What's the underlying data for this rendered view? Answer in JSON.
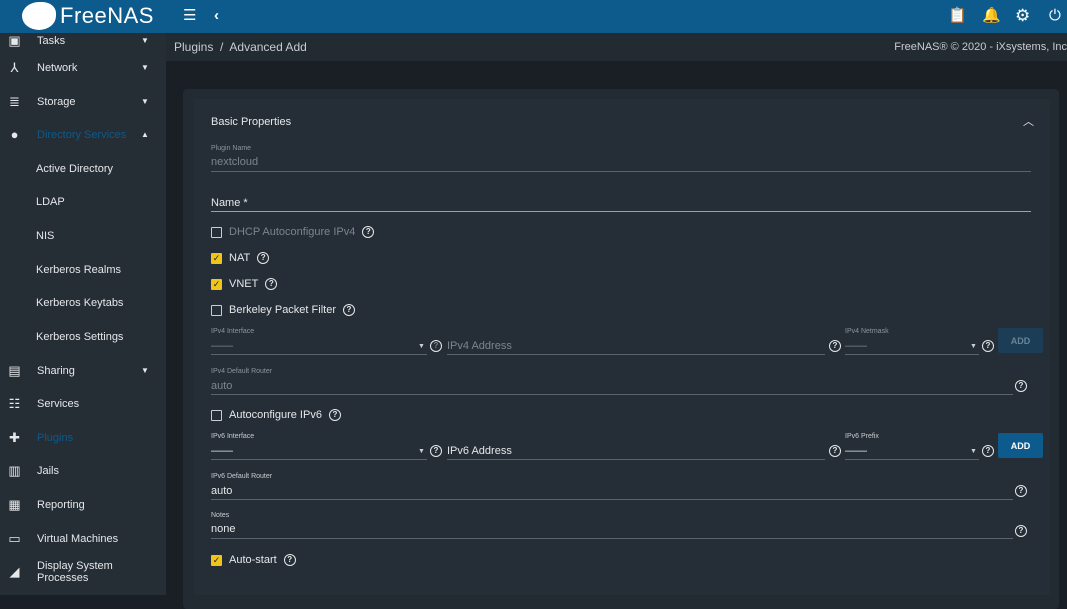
{
  "app": {
    "name": "FreeNAS"
  },
  "header": {
    "icons": [
      "menu-icon",
      "chevron-left-icon",
      "clipboard-icon",
      "bell-icon",
      "gear-icon",
      "power-icon"
    ]
  },
  "sidebar": {
    "items": [
      {
        "label": "Tasks",
        "icon": "calendar-icon",
        "caret": "▼"
      },
      {
        "label": "Network",
        "icon": "network-icon",
        "caret": "▼"
      },
      {
        "label": "Storage",
        "icon": "storage-icon",
        "caret": "▼"
      },
      {
        "label": "Directory Services",
        "icon": "directory-icon",
        "caret": "▲",
        "active": true
      },
      {
        "label": "Active Directory",
        "sub": true
      },
      {
        "label": "LDAP",
        "sub": true
      },
      {
        "label": "NIS",
        "sub": true
      },
      {
        "label": "Kerberos Realms",
        "sub": true
      },
      {
        "label": "Kerberos Keytabs",
        "sub": true
      },
      {
        "label": "Kerberos Settings",
        "sub": true
      },
      {
        "label": "Sharing",
        "icon": "sharing-icon",
        "caret": "▼"
      },
      {
        "label": "Services",
        "icon": "sliders-icon"
      },
      {
        "label": "Plugins",
        "icon": "puzzle-icon",
        "active": true
      },
      {
        "label": "Jails",
        "icon": "jail-icon"
      },
      {
        "label": "Reporting",
        "icon": "chart-icon"
      },
      {
        "label": "Virtual Machines",
        "icon": "laptop-icon"
      },
      {
        "label": "Display System Processes",
        "icon": "processes-icon"
      }
    ]
  },
  "breadcrumb": {
    "parent": "Plugins",
    "sep": "/",
    "current": "Advanced Add"
  },
  "copyright": "FreeNAS® © 2020 - iXsystems, Inc",
  "form": {
    "section_title": "Basic Properties",
    "plugin_name_label": "Plugin Name",
    "plugin_name": "nextcloud",
    "name_label": "Name *",
    "dhcp": "DHCP Autoconfigure IPv4",
    "nat": "NAT",
    "vnet": "VNET",
    "bpf": "Berkeley Packet Filter",
    "ipv4_interface_label": "IPv4 Interface",
    "ipv4_interface": "——",
    "ipv4_address_placeholder": "IPv4 Address",
    "ipv4_netmask_label": "IPv4 Netmask",
    "ipv4_netmask": "——",
    "add": "ADD",
    "ipv4_router_label": "IPv4 Default Router",
    "ipv4_router": "auto",
    "auto_ipv6": "Autoconfigure IPv6",
    "ipv6_interface_label": "IPv6 Interface",
    "ipv6_interface": "——",
    "ipv6_address_placeholder": "IPv6 Address",
    "ipv6_prefix_label": "IPv6 Prefix",
    "ipv6_prefix": "——",
    "ipv6_router_label": "IPv6 Default Router",
    "ipv6_router": "auto",
    "notes_label": "Notes",
    "notes": "none",
    "autostart": "Auto-start"
  },
  "colors": {
    "topbar": "#0d5a8c",
    "checkbox": "#f0c419",
    "accent": "#0d5a8c"
  }
}
